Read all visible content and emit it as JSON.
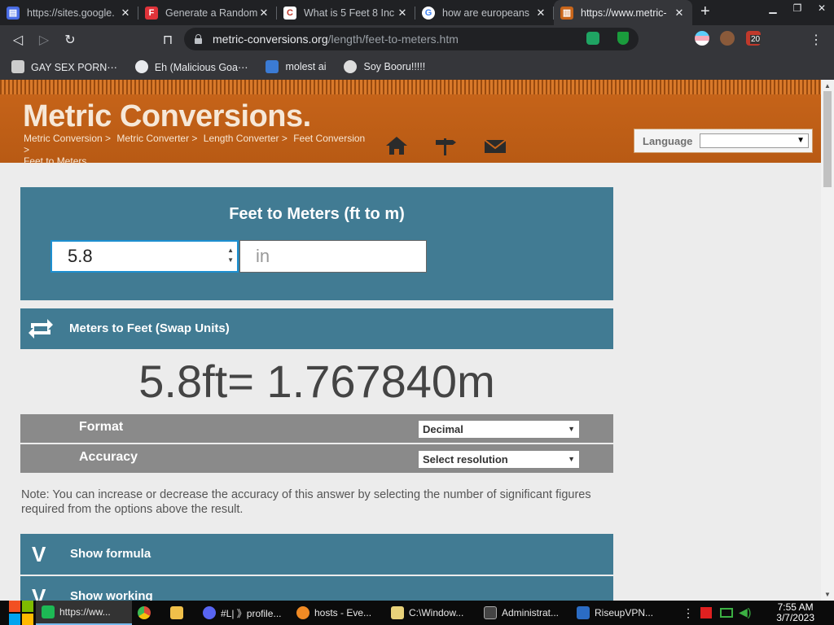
{
  "browser": {
    "tabs": [
      {
        "title": "https://sites.google.",
        "favicon": "google-sites-icon",
        "color": "#4a6de5"
      },
      {
        "title": "Generate a Random",
        "favicon": "F",
        "color": "#e0333a"
      },
      {
        "title": "What is 5 Feet 8 Inc",
        "favicon": "C",
        "color": "#ffffff"
      },
      {
        "title": "how are europeans",
        "favicon": "G",
        "color": "#ffffff"
      },
      {
        "title": "https://www.metric-",
        "favicon": "metric-icon",
        "color": "#c8651a",
        "active": true
      }
    ],
    "url_host": "metric-conversions.org",
    "url_path": "/length/feet-to-meters.htm",
    "bookmarks": [
      {
        "label": "GAY SEX PORN⋯"
      },
      {
        "label": "Eh (Malicious Goa⋯"
      },
      {
        "label": "molest ai"
      },
      {
        "label": "Soy Booru!!!!!"
      }
    ],
    "ext_badge": "20"
  },
  "header": {
    "logo": "Metric Conversions.",
    "breadcrumbs": [
      "Metric Conversion >",
      "Metric Converter >",
      "Length Converter >",
      "Feet Conversion >",
      "Feet to Meters"
    ],
    "language_label": "Language"
  },
  "calculator": {
    "title": "Feet to Meters (ft to m)",
    "value": "5.8",
    "unit_placeholder": "in",
    "swap_label": "Meters to Feet (Swap Units)",
    "result": "5.8ft= 1.767840m",
    "format_label": "Format",
    "format_value": "Decimal",
    "accuracy_label": "Accuracy",
    "accuracy_value": "Select resolution",
    "note": "Note: You can increase or decrease the accuracy of this answer by selecting the number of significant figures required from the options above the result.",
    "show_formula": "Show formula",
    "show_working": "Show working",
    "v_label": "V"
  },
  "taskbar": {
    "items": [
      {
        "label": "https://ww...",
        "color": "#1db954"
      },
      {
        "label": "",
        "color": "#dd4b39"
      },
      {
        "label": "",
        "color": "#f0c04a"
      },
      {
        "label": "#L| 》profile...",
        "color": "#5865f2"
      },
      {
        "label": "hosts - Eve...",
        "color": "#f08a24"
      },
      {
        "label": "C:\\Window...",
        "color": "#e8d27a"
      },
      {
        "label": "Administrat...",
        "color": "#444"
      },
      {
        "label": "RiseupVPN...",
        "color": "#2b6cc4"
      }
    ],
    "time": "7:55 AM",
    "date": "3/7/2023"
  },
  "colors": {
    "accent": "#417b93",
    "header": "#c8651a"
  }
}
